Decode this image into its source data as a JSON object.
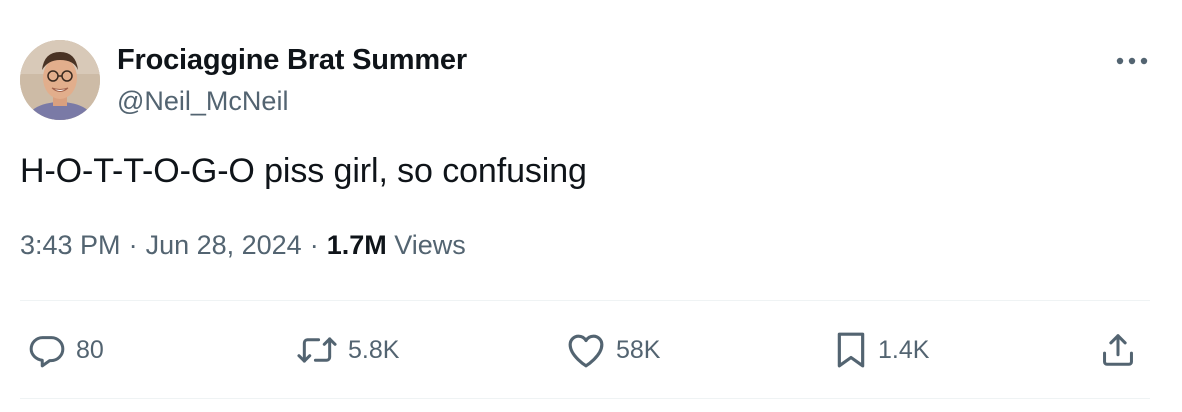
{
  "user": {
    "display_name": "Frociaggine Brat Summer",
    "handle": "@Neil_McNeil",
    "avatar_icon": "profile-photo"
  },
  "tweet": {
    "text": "H-O-T-T-O-G-O piss girl, so confusing",
    "time": "3:43 PM",
    "separator": "·",
    "date": "Jun 28, 2024",
    "views_count": "1.7M",
    "views_label": "Views"
  },
  "actions": {
    "replies": "80",
    "reposts": "5.8K",
    "likes": "58K",
    "bookmarks": "1.4K"
  },
  "icons": {
    "more": "more-horizontal-icon",
    "reply": "reply-bubble-icon",
    "repost": "repost-arrows-icon",
    "like": "heart-icon",
    "bookmark": "bookmark-icon",
    "share": "share-upload-icon"
  },
  "colors": {
    "text_primary": "#0f1419",
    "text_secondary": "#536471",
    "divider": "#eff3f4"
  }
}
